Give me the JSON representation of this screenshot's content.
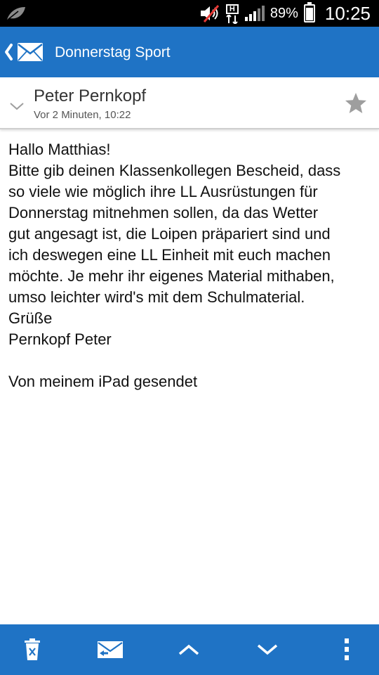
{
  "status_bar": {
    "battery_percent": "89%",
    "time": "10:25",
    "icons": [
      "leaf-icon",
      "volume-mute-icon",
      "hplus-data-icon",
      "signal-icon",
      "battery-icon"
    ],
    "battery_level": 0.89
  },
  "title_bar": {
    "title": "Donnerstag Sport",
    "icons": [
      "back-chevron-icon",
      "mail-icon"
    ]
  },
  "message": {
    "sender": "Peter Pernkopf",
    "time": "Vor 2 Minuten, 10:22",
    "body_lines": [
      "Hallo Matthias!",
      "Bitte gib deinen Klassenkollegen Bescheid, dass",
      "so viele wie möglich ihre LL Ausrüstungen für",
      "Donnerstag mitnehmen sollen, da das Wetter",
      "gut angesagt ist, die Loipen präpariert sind und",
      "ich deswegen eine LL Einheit mit euch machen",
      "möchte. Je mehr ihr eigenes Material mithaben,",
      "umso leichter wird's mit dem Schulmaterial.",
      "Grüße",
      "Pernkopf Peter",
      "",
      "Von meinem iPad gesendet"
    ]
  },
  "bottom_bar": {
    "icons": [
      "delete-icon",
      "reply-mail-icon",
      "previous-chevron-up-icon",
      "next-chevron-down-icon",
      "overflow-menu-icon"
    ]
  },
  "colors": {
    "accent": "#1f73c5",
    "status_bar": "#000000",
    "star": "#9e9e9e"
  }
}
